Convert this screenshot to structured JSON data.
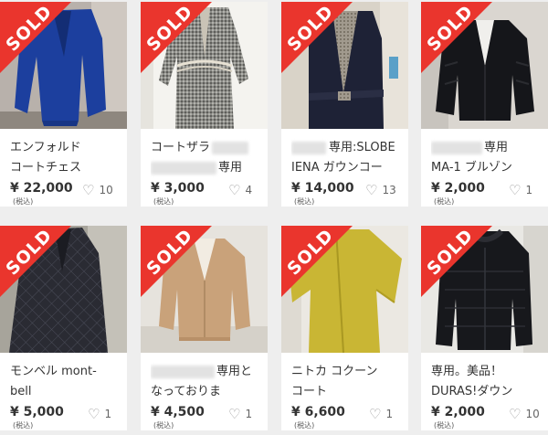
{
  "colors": {
    "sold_banner": "#ea352d",
    "background": "#eeeeee"
  },
  "icons": {
    "like": "heart-outline-icon"
  },
  "items": [
    {
      "sold_label": "SOLD",
      "title_line1": "エンフォルド",
      "title_line2": "コートチェス",
      "price": "¥ 22,000",
      "tax": "(税込)",
      "likes": "10"
    },
    {
      "sold_label": "SOLD",
      "title_line1": "コートザラ",
      "title_line2": "専用",
      "price": "¥ 3,000",
      "tax": "(税込)",
      "likes": "4"
    },
    {
      "sold_label": "SOLD",
      "title_line1": "専用:SLOBE",
      "title_line2": "IENA ガウンコー",
      "price": "¥ 14,000",
      "tax": "(税込)",
      "likes": "13"
    },
    {
      "sold_label": "SOLD",
      "title_line1": "専用",
      "title_line2": "MA-1 ブルゾン",
      "price": "¥ 2,000",
      "tax": "(税込)",
      "likes": "1"
    },
    {
      "sold_label": "SOLD",
      "title_line1": "モンベル mont-",
      "title_line2": "bell",
      "price": "¥ 5,000",
      "tax": "(税込)",
      "likes": "1"
    },
    {
      "sold_label": "SOLD",
      "title_line1": "専用と",
      "title_line2": "なっておりま",
      "price": "¥ 4,500",
      "tax": "(税込)",
      "likes": "1"
    },
    {
      "sold_label": "SOLD",
      "title_line1": "ニトカ コクーン",
      "title_line2": "コート",
      "price": "¥ 6,600",
      "tax": "(税込)",
      "likes": "1"
    },
    {
      "sold_label": "SOLD",
      "title_line1": "専用。美品！",
      "title_line2": "DURAS!ダウン",
      "price": "¥ 2,000",
      "tax": "(税込)",
      "likes": "10"
    }
  ]
}
